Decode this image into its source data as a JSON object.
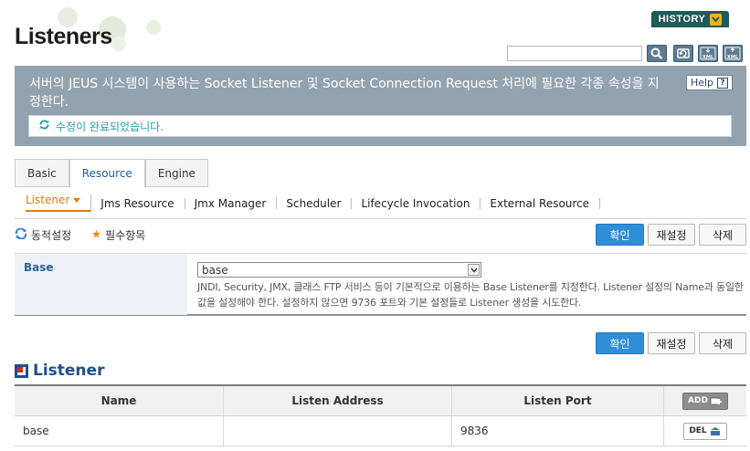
{
  "header": {
    "title": "Listeners",
    "history_label": "HISTORY",
    "search_placeholder": "",
    "tools": [
      "search-icon",
      "refresh-icon",
      "xml-export-icon",
      "xml-import-icon"
    ]
  },
  "description": {
    "text": "서버의 JEUS 시스템이 사용하는 Socket Listener 및 Socket Connection Request 처리에 필요한 각종 속성을 지정한다.",
    "help_label": "Help",
    "help_symbol": "?",
    "message": "수정이 완료되었습니다."
  },
  "tabs": [
    {
      "label": "Basic"
    },
    {
      "label": "Resource"
    },
    {
      "label": "Engine"
    }
  ],
  "subnav": [
    {
      "label": "Listener"
    },
    {
      "label": "Jms Resource"
    },
    {
      "label": "Jmx Manager"
    },
    {
      "label": "Scheduler"
    },
    {
      "label": "Lifecycle Invocation"
    },
    {
      "label": "External Resource"
    }
  ],
  "legend": {
    "dynamic": "동적설정",
    "required": "필수항목"
  },
  "actions": {
    "confirm": "확인",
    "reset": "재설정",
    "delete": "삭제"
  },
  "form": {
    "label": "Base",
    "value": "base",
    "help": "JNDI, Security, JMX, 클래스 FTP 서비스 등이 기본적으로 이용하는 Base Listener를 지정한다. Listener 설정의 Name과 동일한 값을 설정해야 한다. 설정하지 않으면 9736 포트와 기본 설정들로 Listener 생성을 시도한다."
  },
  "listener_section": {
    "title": "Listener",
    "columns": [
      "Name",
      "Listen Address",
      "Listen Port"
    ],
    "add_label": "ADD",
    "del_label": "DEL",
    "rows": [
      {
        "name": "base",
        "address": "",
        "port": "9836"
      }
    ]
  },
  "colors": {
    "accent_tab": "#1d5d9c",
    "active_subnav": "#e17b0e",
    "primary_button": "#2f8ed8",
    "description_bg": "#93a2af",
    "message_text": "#279faa",
    "history_bg": "#1e5b5a"
  }
}
